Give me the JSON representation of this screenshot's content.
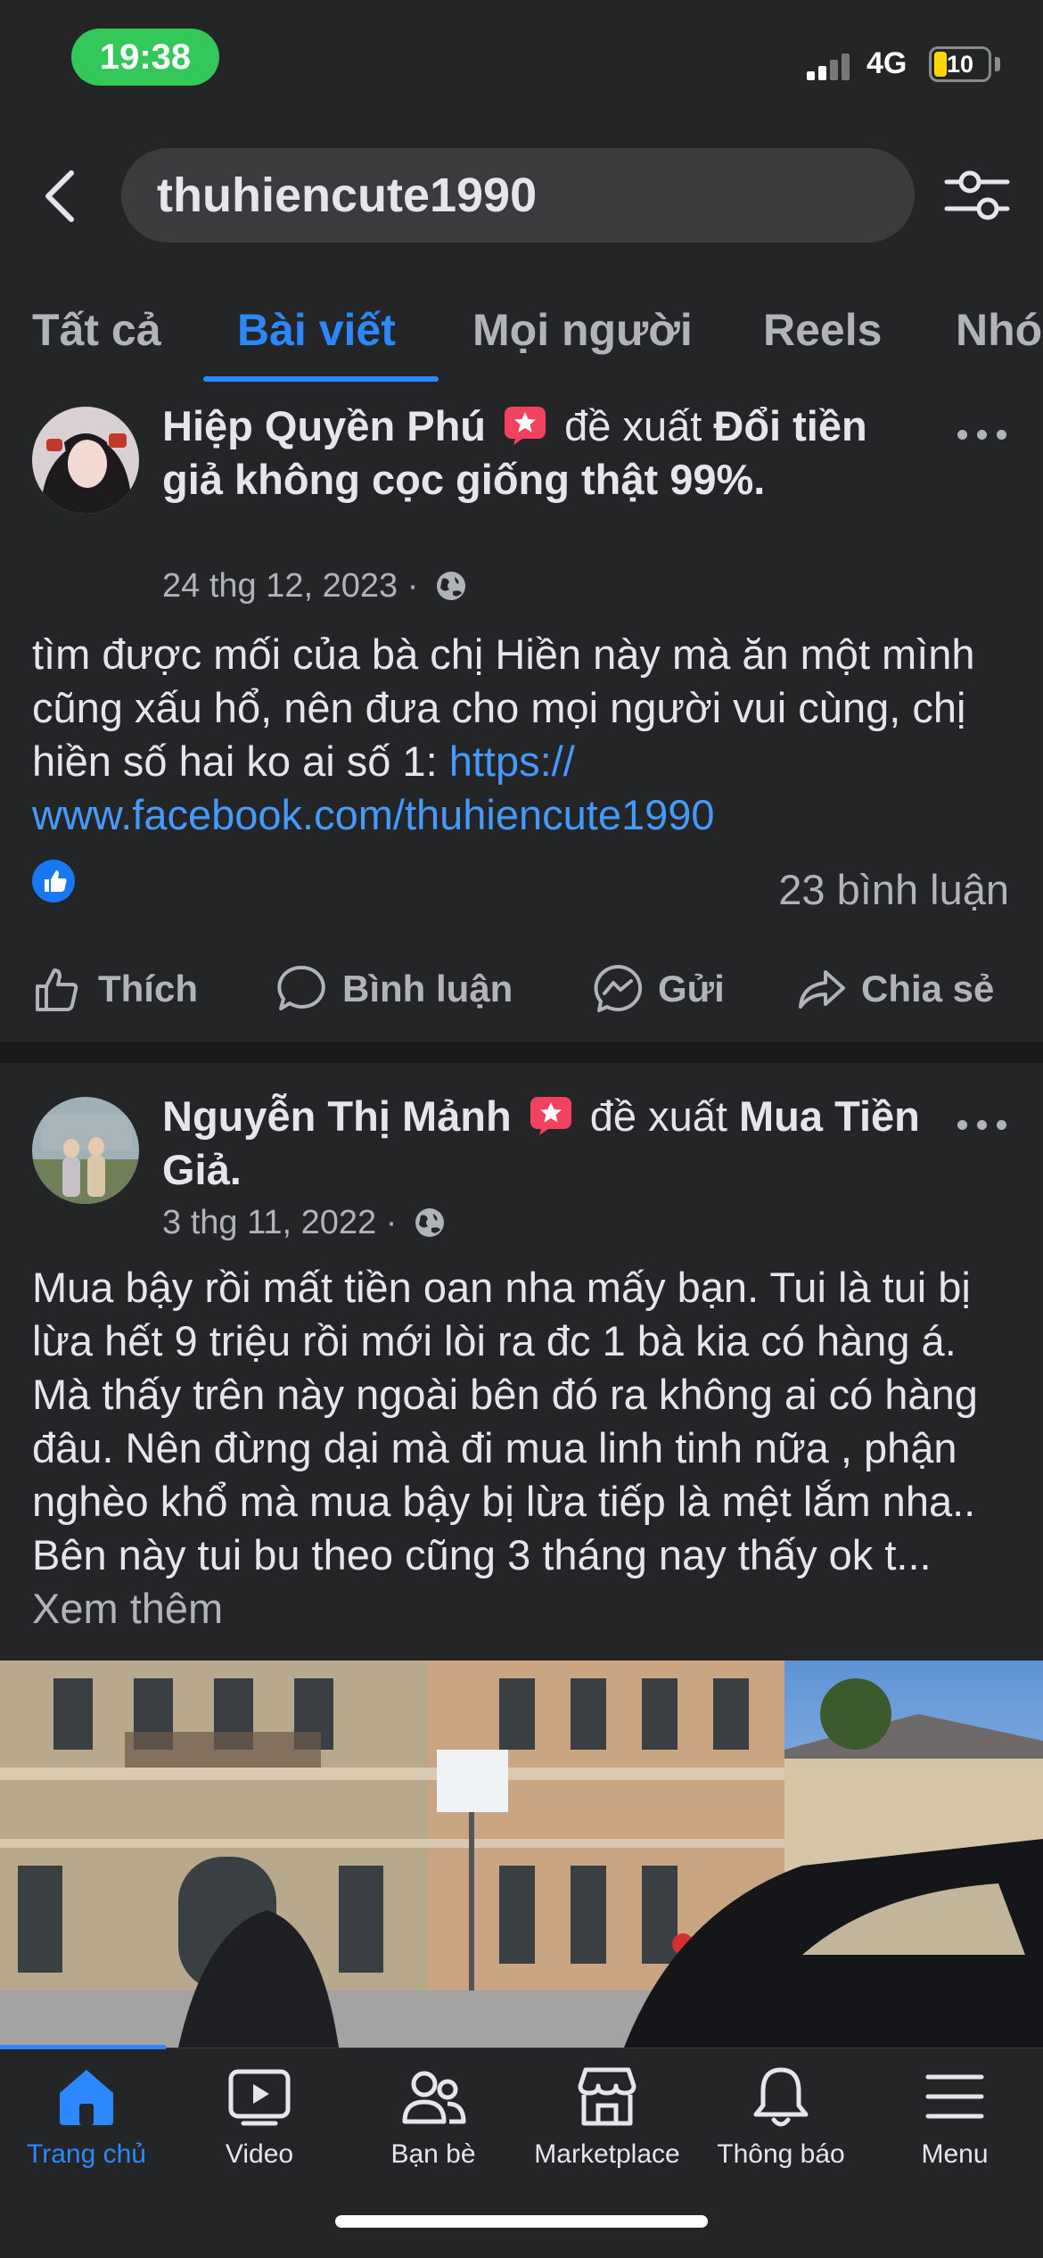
{
  "status_bar": {
    "time": "19:38",
    "network": "4G",
    "battery_level": "10"
  },
  "search": {
    "query": "thuhiencute1990"
  },
  "tabs": [
    {
      "label": "Tất cả"
    },
    {
      "label": "Bài viết",
      "active": true
    },
    {
      "label": "Mọi người"
    },
    {
      "label": "Reels"
    },
    {
      "label": "Nhó"
    }
  ],
  "posts": [
    {
      "author": "Hiệp Quyền Phú",
      "verb": "đề xuất",
      "topic": "Đổi tiền giả không cọc giống thật 99%.",
      "date": "24 thg 12, 2023",
      "text": "tìm được mối của bà chị Hiền này mà ăn một mình cũng xấu hổ, nên đưa cho mọi người vui cùng, chị hiền số hai ko ai số 1: ",
      "link": "https:// www.facebook.com/thuhiencute1990",
      "comments": "23 bình luận",
      "actions": {
        "like": "Thích",
        "comment": "Bình luận",
        "send": "Gửi",
        "share": "Chia sẻ"
      }
    },
    {
      "author": "Nguyễn Thị Mảnh",
      "verb": "đề xuất",
      "topic": "Mua Tiền Giả.",
      "date": "3 thg 11, 2022",
      "text": "Mua bậy rồi mất tiền oan nha mấy bạn. Tui là tui bị lừa hết 9 triệu rồi mới lòi ra đc 1 bà kia có hàng á.  Mà thấy trên này ngoài bên đó ra không ai có hàng đâu. Nên đừng dại mà đi mua linh tinh nữa , phận nghèo khổ mà mua bậy bị lừa tiếp là mệt lắm nha.. Bên này tui bu theo cũng 3 tháng nay thấy ok t...",
      "see_more": "Xem thêm"
    }
  ],
  "bottom_nav": [
    {
      "label": "Trang chủ",
      "icon": "home-icon",
      "active": true
    },
    {
      "label": "Video",
      "icon": "video-icon"
    },
    {
      "label": "Bạn bè",
      "icon": "friends-icon"
    },
    {
      "label": "Marketplace",
      "icon": "marketplace-icon"
    },
    {
      "label": "Thông báo",
      "icon": "bell-icon"
    },
    {
      "label": "Menu",
      "icon": "menu-icon"
    }
  ],
  "colors": {
    "background": "#242526",
    "accent": "#2d88ff",
    "link": "#4599ff",
    "status_green": "#34c759"
  }
}
